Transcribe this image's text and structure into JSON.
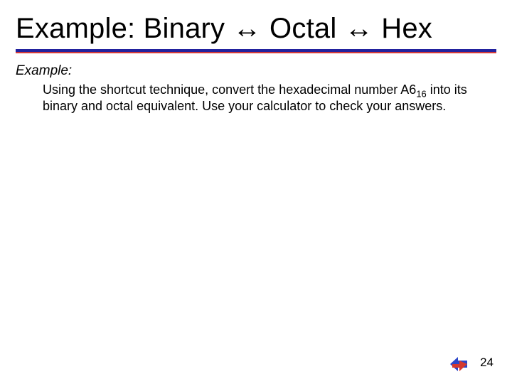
{
  "slide": {
    "title": "Example: Binary ↔ Octal ↔ Hex",
    "example_label": "Example:",
    "body_pre": "Using the shortcut technique, convert the hexadecimal number A6",
    "body_sub": "16",
    "body_post": " into its binary and octal equivalent. Use your calculator to check your answers.",
    "page_number": "24"
  }
}
